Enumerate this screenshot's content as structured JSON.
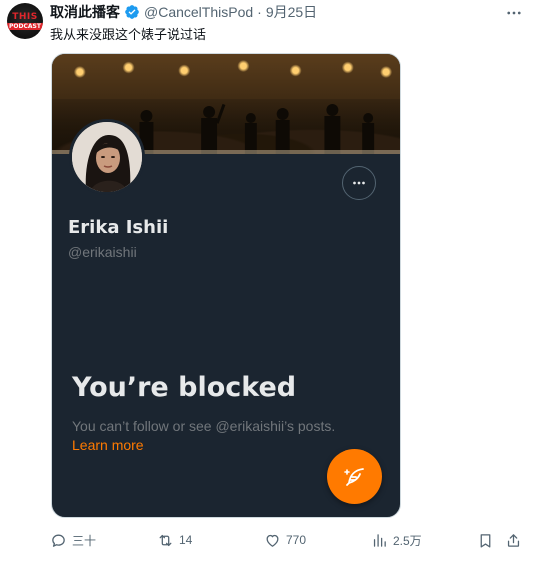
{
  "tweet": {
    "display_name": "取消此播客",
    "handle": "@CancelThisPod",
    "separator": "·",
    "date": "9月25日",
    "text": "我从来没跟这个婊子说过话",
    "avatar_logo_top": "THIS",
    "avatar_logo_bottom": "PODCAST"
  },
  "profile_card": {
    "name": "Erika Ishii",
    "handle": "@erikaishii",
    "blocked_title": "You’re blocked",
    "blocked_description": "You can’t follow or see @erikaishii’s posts.",
    "learn_more": "Learn more",
    "accent_color": "#ff7a00",
    "background_color": "#1b2530"
  },
  "actions": {
    "replies": "三十",
    "retweets": "14",
    "likes": "770",
    "views": "2.5万"
  },
  "icons": {
    "verified": "verified-badge-icon",
    "more": "more-horizontal-icon",
    "reply": "reply-icon",
    "retweet": "retweet-icon",
    "like": "heart-icon",
    "views": "views-chart-icon",
    "bookmark": "bookmark-icon",
    "share": "share-icon",
    "compose": "compose-feather-icon"
  }
}
